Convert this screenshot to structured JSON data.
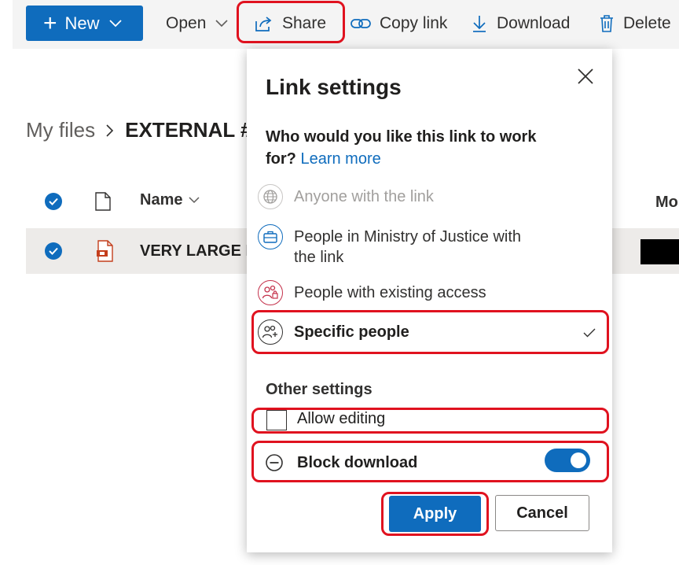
{
  "toolbar": {
    "new_label": "New",
    "open_label": "Open",
    "share_label": "Share",
    "copy_link_label": "Copy link",
    "download_label": "Download",
    "delete_label": "Delete"
  },
  "breadcrumb": {
    "root": "My files",
    "current": "EXTERNAL #1"
  },
  "list": {
    "col_name": "Name",
    "col_modified": "Mo",
    "row_name": "VERY LARGE FI"
  },
  "panel": {
    "title": "Link settings",
    "question": "Who would you like this link to work for?",
    "learn_more": "Learn more",
    "options": [
      {
        "label": "Anyone with the link",
        "icon": "globe-icon",
        "state": "disabled"
      },
      {
        "label": "People in Ministry of Justice with the link",
        "icon": "briefcase-icon",
        "state": "enabled"
      },
      {
        "label": "People with existing access",
        "icon": "people-lock-icon",
        "state": "enabled"
      },
      {
        "label": "Specific people",
        "icon": "specific-people-icon",
        "state": "selected"
      }
    ],
    "other_settings": "Other settings",
    "allow_editing": "Allow editing",
    "allow_editing_checked": false,
    "block_download": "Block download",
    "block_download_on": true,
    "apply": "Apply",
    "cancel": "Cancel"
  },
  "colors": {
    "accent": "#0f6cbd",
    "highlight": "#e0121f",
    "people_lock_icon": "#c4314b",
    "disabled_text": "#a19f9d"
  }
}
